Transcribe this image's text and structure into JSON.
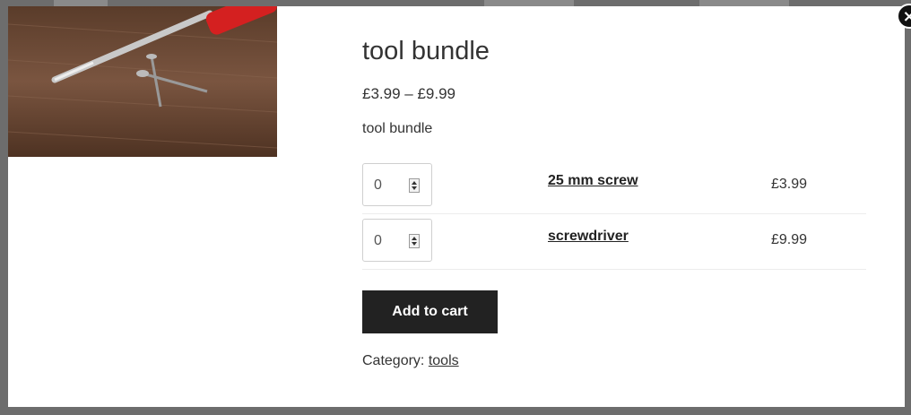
{
  "modal": {
    "close_label": "×",
    "close_icon": "close-icon"
  },
  "product": {
    "image_icon": "product-photo-screwdriver-screws",
    "title": "tool bundle",
    "price_range": "£3.99 – £9.99",
    "short_description": "tool bundle",
    "grouped_items": [
      {
        "qty": "0",
        "name": "25 mm screw",
        "price": "£3.99"
      },
      {
        "qty": "0",
        "name": "screwdriver",
        "price": "£9.99"
      }
    ],
    "add_to_cart_label": "Add to cart",
    "category_label": "Category:",
    "category_link": "tools"
  },
  "colors": {
    "button_bg": "#222222",
    "overlay": "#4a4a4a",
    "modal_bg": "#ffffff"
  }
}
